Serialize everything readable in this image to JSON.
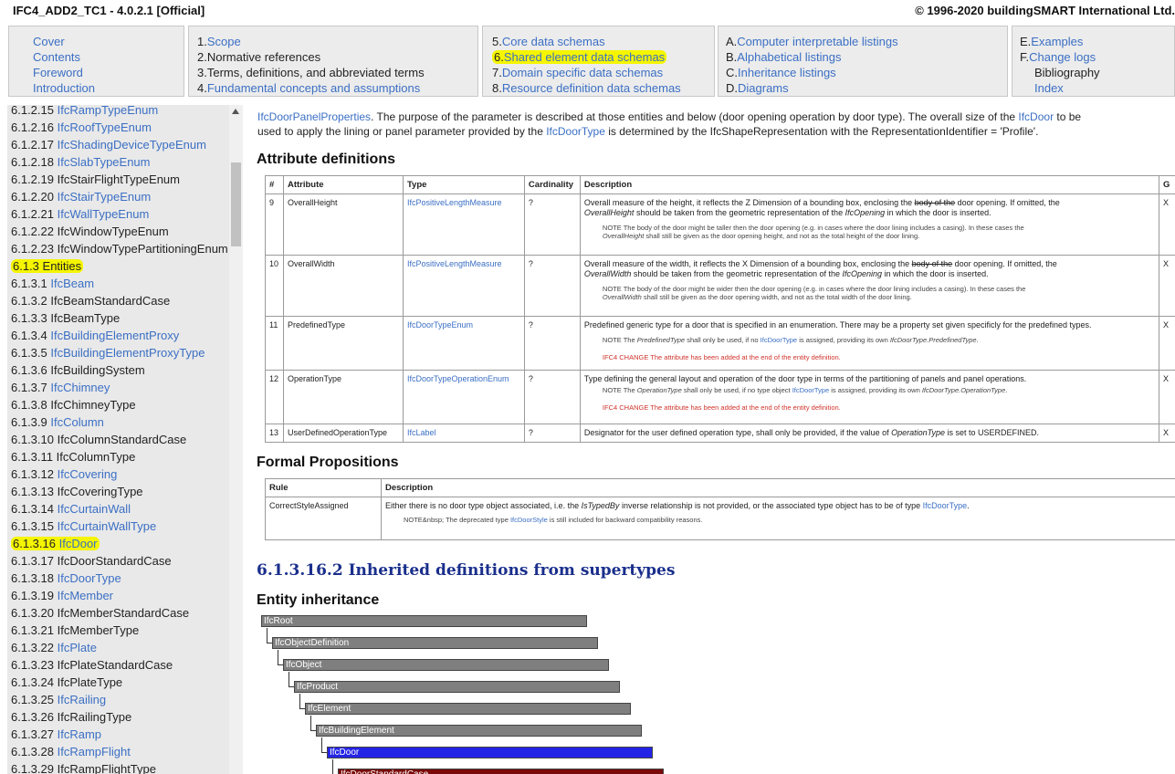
{
  "titlebar": {
    "left": "IFC4_ADD2_TC1 - 4.0.2.1 [Official]",
    "right": "© 1996-2020 buildingSMART International Ltd."
  },
  "topnav": {
    "box1": [
      "Cover",
      "Contents",
      "Foreword",
      "Introduction"
    ],
    "box2": [
      {
        "num": "1. ",
        "label": "Scope",
        "link": true
      },
      {
        "num": "2. ",
        "label": "Normative references",
        "link": false
      },
      {
        "num": "3. ",
        "label": "Terms, definitions, and abbreviated terms",
        "link": false
      },
      {
        "num": "4. ",
        "label": "Fundamental concepts and assumptions",
        "link": true
      }
    ],
    "box3": [
      {
        "num": "5. ",
        "label": "Core data schemas"
      },
      {
        "num": "6. ",
        "label": "Shared element data schemas"
      },
      {
        "num": "7. ",
        "label": "Domain specific data schemas"
      },
      {
        "num": "8. ",
        "label": "Resource definition data schemas"
      }
    ],
    "box4": [
      {
        "num": "A. ",
        "label": "Computer interpretable listings"
      },
      {
        "num": "B. ",
        "label": "Alphabetical listings"
      },
      {
        "num": "C. ",
        "label": "Inheritance listings"
      },
      {
        "num": "D. ",
        "label": "Diagrams"
      }
    ],
    "box5": [
      {
        "num": "E. ",
        "label": "Examples",
        "link": true
      },
      {
        "num": "F. ",
        "label": "Change logs",
        "link": true
      },
      {
        "num": "",
        "label": "Bibliography",
        "link": false
      },
      {
        "num": "",
        "label": "Index",
        "link": true
      }
    ]
  },
  "sidebar": {
    "items": [
      {
        "num": "6.1.2.15 ",
        "label": "IfcRampTypeEnum",
        "link": true
      },
      {
        "num": "6.1.2.16 ",
        "label": "IfcRoofTypeEnum",
        "link": true
      },
      {
        "num": "6.1.2.17 ",
        "label": "IfcShadingDeviceTypeEnum",
        "link": true
      },
      {
        "num": "6.1.2.18 ",
        "label": "IfcSlabTypeEnum",
        "link": true
      },
      {
        "num": "6.1.2.19 ",
        "label": "IfcStairFlightTypeEnum",
        "link": false
      },
      {
        "num": "6.1.2.20 ",
        "label": "IfcStairTypeEnum",
        "link": true
      },
      {
        "num": "6.1.2.21 ",
        "label": "IfcWallTypeEnum",
        "link": true
      },
      {
        "num": "6.1.2.22 ",
        "label": "IfcWindowTypeEnum",
        "link": false
      },
      {
        "num": "6.1.2.23 ",
        "label": "IfcWindowTypePartitioningEnum",
        "link": false
      },
      {
        "num": "6.1.3 ",
        "label": "Entities",
        "link": false,
        "highlight": true
      },
      {
        "num": "6.1.3.1 ",
        "label": "IfcBeam",
        "link": true
      },
      {
        "num": "6.1.3.2 ",
        "label": "IfcBeamStandardCase",
        "link": false
      },
      {
        "num": "6.1.3.3 ",
        "label": "IfcBeamType",
        "link": false
      },
      {
        "num": "6.1.3.4 ",
        "label": "IfcBuildingElementProxy",
        "link": true
      },
      {
        "num": "6.1.3.5 ",
        "label": "IfcBuildingElementProxyType",
        "link": true
      },
      {
        "num": "6.1.3.6 ",
        "label": "IfcBuildingSystem",
        "link": false
      },
      {
        "num": "6.1.3.7 ",
        "label": "IfcChimney",
        "link": true
      },
      {
        "num": "6.1.3.8 ",
        "label": "IfcChimneyType",
        "link": false
      },
      {
        "num": "6.1.3.9 ",
        "label": "IfcColumn",
        "link": true
      },
      {
        "num": "6.1.3.10 ",
        "label": "IfcColumnStandardCase",
        "link": false
      },
      {
        "num": "6.1.3.11 ",
        "label": "IfcColumnType",
        "link": false
      },
      {
        "num": "6.1.3.12 ",
        "label": "IfcCovering",
        "link": true
      },
      {
        "num": "6.1.3.13 ",
        "label": "IfcCoveringType",
        "link": false
      },
      {
        "num": "6.1.3.14 ",
        "label": "IfcCurtainWall",
        "link": true
      },
      {
        "num": "6.1.3.15 ",
        "label": "IfcCurtainWallType",
        "link": true
      },
      {
        "num": "6.1.3.16 ",
        "label": "IfcDoor",
        "link": true,
        "highlight": true
      },
      {
        "num": "6.1.3.17 ",
        "label": "IfcDoorStandardCase",
        "link": false
      },
      {
        "num": "6.1.3.18 ",
        "label": "IfcDoorType",
        "link": true
      },
      {
        "num": "6.1.3.19 ",
        "label": "IfcMember",
        "link": true
      },
      {
        "num": "6.1.3.20 ",
        "label": "IfcMemberStandardCase",
        "link": false
      },
      {
        "num": "6.1.3.21 ",
        "label": "IfcMemberType",
        "link": false
      },
      {
        "num": "6.1.3.22 ",
        "label": "IfcPlate",
        "link": true
      },
      {
        "num": "6.1.3.23 ",
        "label": "IfcPlateStandardCase",
        "link": false
      },
      {
        "num": "6.1.3.24 ",
        "label": "IfcPlateType",
        "link": false
      },
      {
        "num": "6.1.3.25 ",
        "label": "IfcRailing",
        "link": true
      },
      {
        "num": "6.1.3.26 ",
        "label": "IfcRailingType",
        "link": false
      },
      {
        "num": "6.1.3.27 ",
        "label": "IfcRamp",
        "link": true
      },
      {
        "num": "6.1.3.28 ",
        "label": "IfcRampFlight",
        "link": true
      },
      {
        "num": "6.1.3.29 ",
        "label": "IfcRampFlightType",
        "link": false
      }
    ]
  },
  "intro": {
    "line1_a": "IfcDoorPanelProperties",
    "line1_b": ". The purpose of the parameter is described at those entities and below (door opening operation by door type). The overall size of the ",
    "line1_c": "IfcDoor",
    "line1_d": " to be",
    "line2_a": "used to apply the lining or panel parameter provided by the ",
    "line2_b": "IfcDoorType",
    "line2_c": " is determined by the IfcShapeRepresentation with the RepresentationIdentifier = 'Profile'."
  },
  "attributes": {
    "heading": "Attribute definitions",
    "columns": [
      "#",
      "Attribute",
      "Type",
      "Cardinality",
      "Description",
      "G"
    ],
    "rows": [
      {
        "num": "9",
        "name": "OverallHeight",
        "type": "IfcPositiveLengthMeasure",
        "card": "?",
        "g": "X",
        "desc_a": "Overall measure of the height, it reflects the Z Dimension of a bounding box, enclosing the ",
        "desc_strike": "body of the",
        "desc_b": " door opening. If omitted, the",
        "desc_c": "OverallHeight",
        "desc_d": " should be taken from the geometric representation of the ",
        "desc_e": "IfcOpening",
        "desc_f": " in which the door is inserted.",
        "note1": "NOTE  The body of the door might be taller then the door opening (e.g. in cases where the door lining includes a casing). In these cases the",
        "note2_a": "OverallHeight",
        "note2_b": " shall still be given as the door opening height, and not as the total height of the door lining."
      },
      {
        "num": "10",
        "name": "OverallWidth",
        "type": "IfcPositiveLengthMeasure",
        "card": "?",
        "g": "X",
        "desc_a": "Overall measure of the width, it reflects the X Dimension of a bounding box, enclosing the ",
        "desc_strike": "body of the",
        "desc_b": " door opening. If omitted, the",
        "desc_c": "OverallWidth",
        "desc_d": " should be taken from the geometric representation of the ",
        "desc_e": "IfcOpening",
        "desc_f": " in which the door is inserted.",
        "note1": "NOTE  The body of the door might be wider then the door opening (e.g. in cases where the door lining includes a casing). In these cases the",
        "note2_a": "OverallWidth",
        "note2_b": " shall still be given as the door opening width, and not as the total width of the door lining."
      },
      {
        "num": "11",
        "name": "PredefinedType",
        "type": "IfcDoorTypeEnum",
        "card": "?",
        "g": "X",
        "desc": "Predefined generic type for a door that is specified in an enumeration. There may be a property set given specificly for the predefined types.",
        "note_a": "NOTE  The ",
        "note_b": "PredefinedType",
        "note_c": " shall only be used, if no ",
        "note_d": "IfcDoorType",
        "note_e": " is assigned, providing its own ",
        "note_f": "IfcDoorType.PredefinedType",
        "note_g": ".",
        "change": "IFC4 CHANGE  The attribute has been added at the end of the entity definition."
      },
      {
        "num": "12",
        "name": "OperationType",
        "type": "IfcDoorTypeOperationEnum",
        "card": "?",
        "g": "X",
        "desc": "Type defining the general layout and operation of the door type in terms of the partitioning of panels and panel operations.",
        "note_a": "NOTE  The ",
        "note_b": "OperationType",
        "note_c": " shall only be used, if no type object ",
        "note_d": "IfcDoorType",
        "note_e": " is assigned, providing its own ",
        "note_f": "IfcDoorType.OperationType",
        "note_g": ".",
        "change": "IFC4 CHANGE  The attribute has been added at the end of the entity definition."
      },
      {
        "num": "13",
        "name": "UserDefinedOperationType",
        "type": "IfcLabel",
        "card": "?",
        "g": "X",
        "desc_a": "Designator for the user defined operation type, shall only be provided, if the value of ",
        "desc_b": "OperationType",
        "desc_c": " is set to USERDEFINED."
      }
    ]
  },
  "propositions": {
    "heading": "Formal Propositions",
    "columns": [
      "Rule",
      "Description"
    ],
    "rule": "CorrectStyleAssigned",
    "desc_a": "Either there is no door type object associated, i.e. the ",
    "desc_b": "IsTypedBy",
    "desc_c": " inverse relationship is not provided, or the associated type object has to be of type ",
    "desc_d": "IfcDoorType",
    "desc_e": ".",
    "note_a": "NOTE&nbsp; The deprecated type ",
    "note_b": "IfcDoorStyle",
    "note_c": " is still included for backward compatibility reasons."
  },
  "inherited": {
    "heading": "6.1.3.16.2   Inherited definitions from supertypes",
    "subheading": "Entity inheritance",
    "chain": [
      "IfcRoot",
      "IfcObjectDefinition",
      "IfcObject",
      "IfcProduct",
      "IfcElement",
      "IfcBuildingElement",
      "IfcDoor",
      "IfcDoorStandardCase"
    ]
  },
  "colors": {
    "link": "#3b6fc4",
    "highlight": "#f5f500",
    "heading_blue": "#1a2f8c",
    "change_red": "#d0342c",
    "tree_gray": "#7f7f7f",
    "tree_current": "#2424e6",
    "tree_sub": "#7a0a0a"
  }
}
